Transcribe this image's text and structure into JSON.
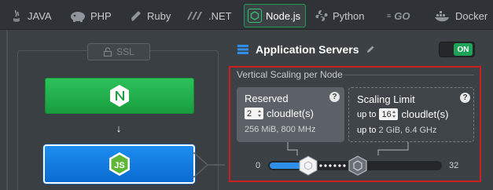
{
  "tabs": [
    {
      "label": "JAVA",
      "icon": "java-icon"
    },
    {
      "label": "PHP",
      "icon": "php-icon"
    },
    {
      "label": "Ruby",
      "icon": "ruby-icon"
    },
    {
      "label": ".NET",
      "icon": "dotnet-icon"
    },
    {
      "label": "Node.js",
      "icon": "nodejs-icon",
      "active": true
    },
    {
      "label": "Python",
      "icon": "python-icon"
    },
    {
      "label": "GO",
      "icon": "go-icon"
    },
    {
      "label": "Docker",
      "icon": "docker-icon"
    }
  ],
  "topology": {
    "ssl_label": "SSL",
    "balancer_icon": "nginx-icon",
    "app_node_icon": "nodejs-icon"
  },
  "app_servers": {
    "title": "Application Servers",
    "toggle_label": "ON",
    "toggle_on": true
  },
  "vertical_scaling": {
    "title": "Vertical Scaling per Node",
    "reserved": {
      "title": "Reserved",
      "help": "?",
      "value": "2",
      "unit": "cloudlet(s)",
      "spec": "256 MiB, 800 MHz"
    },
    "limit": {
      "title": "Scaling Limit",
      "help": "?",
      "prefix": "up to",
      "value": "16",
      "unit": "cloudlet(s)",
      "spec_prefix": "up to",
      "spec": "2 GiB, 6.4 GHz"
    },
    "slider": {
      "min": "0",
      "max": "32",
      "min_value": 0,
      "max_value": 32,
      "reserved_value": 2,
      "limit_value": 16
    }
  },
  "colors": {
    "accent_green": "#1fa356",
    "accent_blue": "#0a6bd1",
    "highlight_red": "#cc1f1f"
  }
}
